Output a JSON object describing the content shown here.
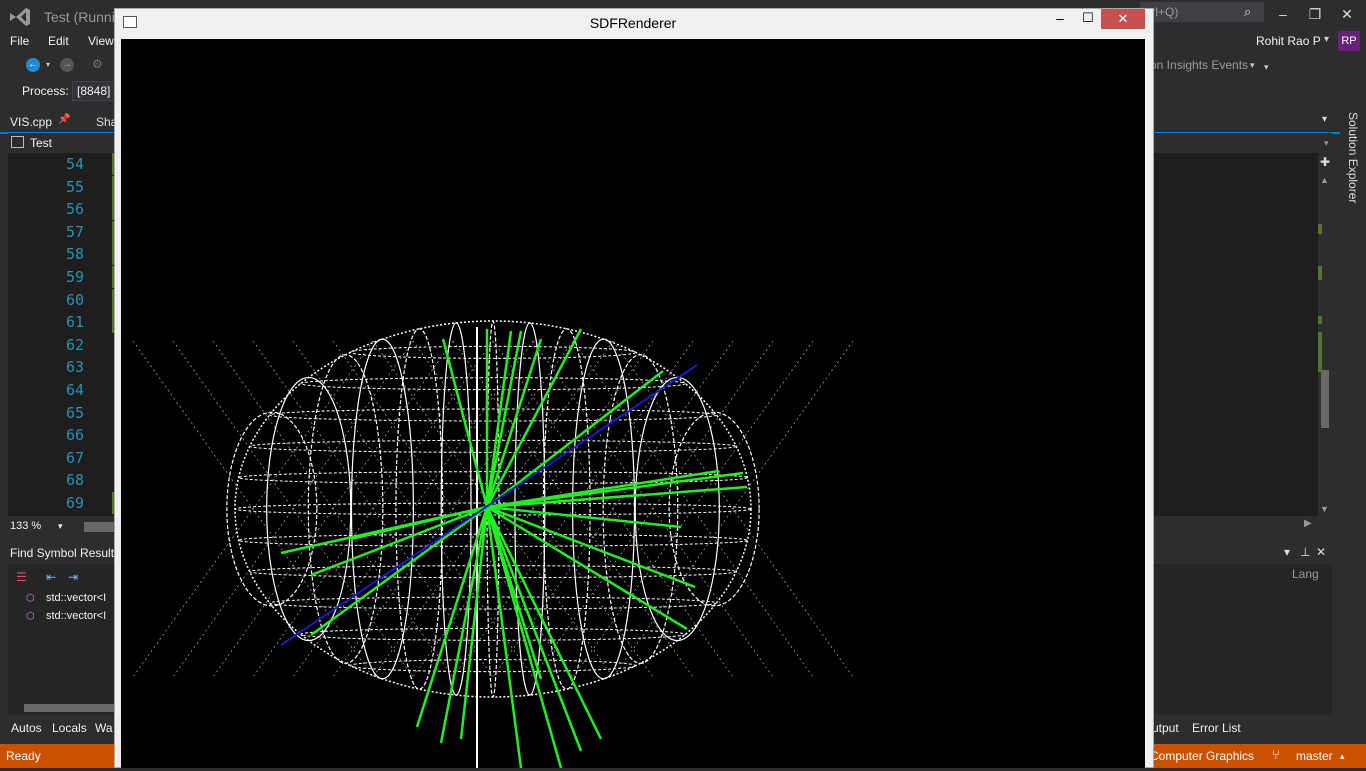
{
  "vs": {
    "title": "Test (Runni",
    "quick_launch": "trl+Q)",
    "menu": [
      "File",
      "Edit",
      "View"
    ],
    "user": "Rohit Rao P",
    "avatar": "RP",
    "app_insights": "on Insights Events",
    "process_label": "Process:",
    "process_value": "[8848]"
  },
  "tabs": {
    "active": "VIS.cpp",
    "second": "Sha",
    "scope": "Test"
  },
  "editor": {
    "line_numbers": [
      "54",
      "55",
      "56",
      "57",
      "58",
      "59",
      "60",
      "61",
      "62",
      "63",
      "64",
      "65",
      "66",
      "67",
      "68",
      "69"
    ],
    "zoom": "133 %"
  },
  "side": {
    "solution_explorer": "Solution Explorer"
  },
  "find_symbol": {
    "title": "Find Symbol Result",
    "results": [
      "std::vector<I",
      "std::vector<I"
    ]
  },
  "bottom_tabs_left": [
    "Autos",
    "Locals",
    "Wa"
  ],
  "bottom_tabs_right": [
    "utput",
    "Error List"
  ],
  "right_panel": {
    "lang_header": "Lang"
  },
  "status": {
    "ready": "Ready",
    "project": "Computer Graphics",
    "branch": "master"
  },
  "sdf_window": {
    "title": "SDFRenderer"
  },
  "colors": {
    "accent": "#007acc",
    "status_bar": "#ca5100",
    "line_number": "#2b91af",
    "avatar": "#68217a",
    "wireframe": "#ffffff",
    "rays": "#22ee22",
    "axis": "#1a1acc"
  },
  "icons": {
    "search": "search-icon",
    "pin": "pin-icon",
    "branch": "git-branch-icon"
  }
}
